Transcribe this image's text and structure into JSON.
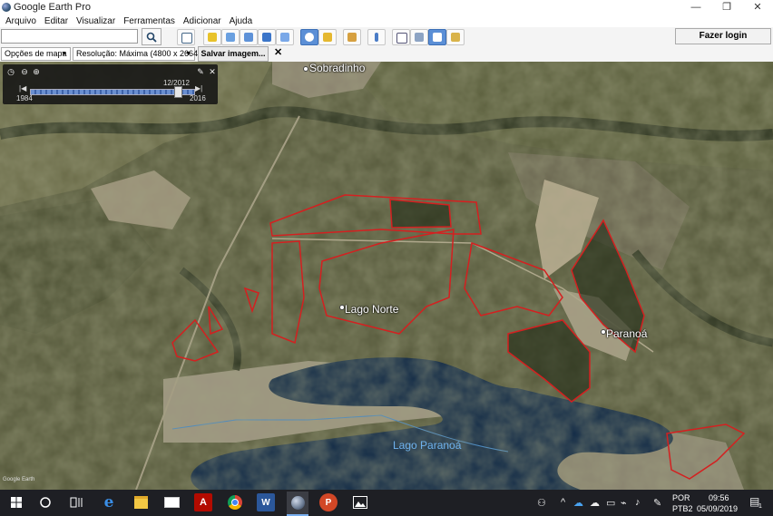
{
  "window": {
    "title": "Google Earth Pro",
    "minimize_glyph": "—",
    "restore_glyph": "❐",
    "close_glyph": "✕"
  },
  "menu": [
    "Arquivo",
    "Editar",
    "Visualizar",
    "Ferramentas",
    "Adicionar",
    "Ajuda"
  ],
  "search": {
    "value": "",
    "placeholder": ""
  },
  "toolbar": {
    "login_label": "Fazer login"
  },
  "toolbar2": {
    "map_options": "Opções de mapa",
    "resolution": "Resolução: Máxima (4800 x 2664)",
    "save_image": "Salvar imagem...",
    "close_glyph": "✕"
  },
  "time_slider": {
    "current": "12/2012",
    "start": "1984",
    "end": "2016",
    "position_fraction": 0.9
  },
  "map": {
    "places": [
      "Sobradinho",
      "Lago Norte",
      "Paranoá"
    ],
    "lake": "Lago Paranoá",
    "watermark": "Google Earth",
    "boundary_color": "#d42020",
    "water_color": "#0f2845"
  },
  "taskbar": {
    "language": "POR",
    "keyboard": "PTB2",
    "time": "09:56",
    "date": "05/09/2019",
    "notifications": "1",
    "apps": [
      "windows-start-icon",
      "cortana-icon",
      "task-view-icon",
      "edge-icon",
      "file-explorer-icon",
      "mail-icon",
      "acrobat-icon",
      "chrome-icon",
      "word-icon",
      "google-earth-icon",
      "powerpoint-icon",
      "photos-icon"
    ]
  }
}
